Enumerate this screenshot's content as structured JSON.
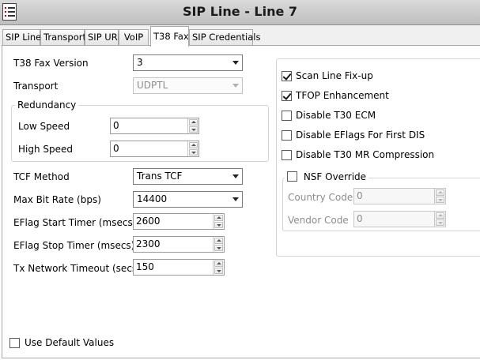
{
  "window": {
    "title": "SIP Line - Line 7",
    "app_icon": "app-menu-icon"
  },
  "tabs": [
    {
      "label": "SIP Line",
      "active": false
    },
    {
      "label": "Transport",
      "active": false
    },
    {
      "label": "SIP URI",
      "active": false
    },
    {
      "label": "VoIP",
      "active": false
    },
    {
      "label": "T38 Fax",
      "active": true
    },
    {
      "label": "SIP Credentials",
      "active": false
    }
  ],
  "form": {
    "t38_fax_version": {
      "label": "T38 Fax Version",
      "value": "3"
    },
    "transport": {
      "label": "Transport",
      "value": "UDPTL",
      "disabled": true
    },
    "redundancy": {
      "title": "Redundancy",
      "low_speed": {
        "label": "Low Speed",
        "value": "0"
      },
      "high_speed": {
        "label": "High Speed",
        "value": "0"
      }
    },
    "tcf_method": {
      "label": "TCF Method",
      "value": "Trans TCF"
    },
    "max_bit_rate": {
      "label": "Max Bit Rate (bps)",
      "value": "14400"
    },
    "eflag_start_timer": {
      "label": "EFlag Start Timer (msecs)",
      "value": "2600"
    },
    "eflag_stop_timer": {
      "label": "EFlag Stop Timer (msecs)",
      "value": "2300"
    },
    "tx_network_timeout": {
      "label": "Tx Network Timeout (secs)",
      "value": "150"
    }
  },
  "options": {
    "scan_line_fixup": {
      "label": "Scan Line Fix-up",
      "checked": true
    },
    "tfop_enhancement": {
      "label": "TFOP Enhancement",
      "checked": true
    },
    "disable_t30_ecm": {
      "label": "Disable T30 ECM",
      "checked": false
    },
    "disable_eflags_first_dis": {
      "label": "Disable EFlags For First DIS",
      "checked": false
    },
    "disable_t30_mr_compression": {
      "label": "Disable T30 MR Compression",
      "checked": false
    }
  },
  "nsf_override": {
    "label": "NSF Override",
    "checked": false,
    "country_code": {
      "label": "Country Code",
      "value": "0",
      "disabled": true
    },
    "vendor_code": {
      "label": "Vendor Code",
      "value": "0",
      "disabled": true
    }
  },
  "use_default_values": {
    "label": "Use Default Values",
    "checked": false
  },
  "colors": {
    "titlebar": "#c8c8c8",
    "border": "#a9a9a9",
    "disabled_text": "#8c8c8c"
  }
}
